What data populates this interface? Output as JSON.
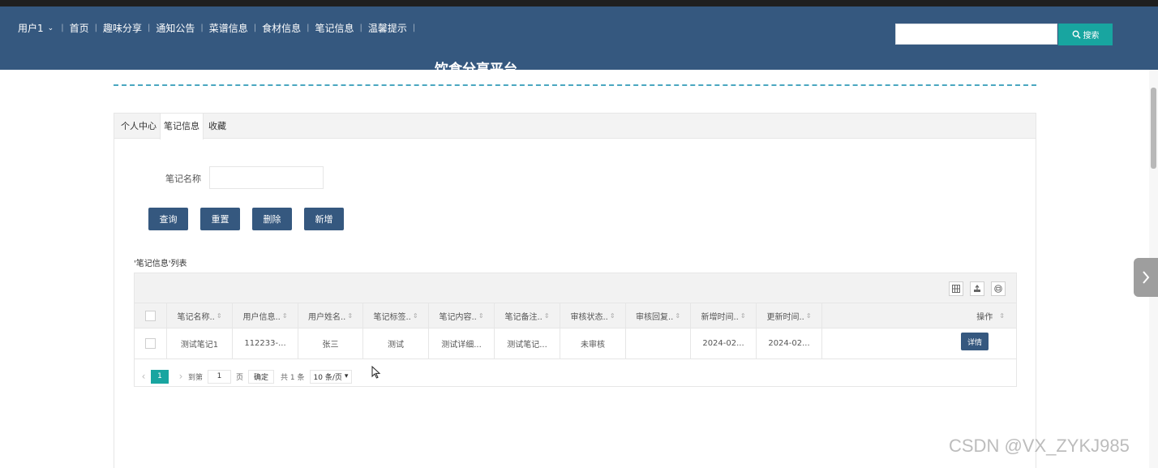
{
  "header": {
    "user_menu": "用户1",
    "nav_items": [
      "首页",
      "趣味分享",
      "通知公告",
      "菜谱信息",
      "食材信息",
      "笔记信息",
      "温馨提示"
    ],
    "search_placeholder": "",
    "search_button": "搜索",
    "site_title": "饮食分享平台"
  },
  "tabs": [
    "个人中心",
    "笔记信息",
    "收藏"
  ],
  "active_tab": "笔记信息",
  "form": {
    "label": "笔记名称",
    "value": ""
  },
  "buttons": {
    "query": "查询",
    "reset": "重置",
    "delete": "删除",
    "add": "新增"
  },
  "list_title": "'笔记信息'列表",
  "table": {
    "columns": [
      "笔记名称..",
      "用户信息..",
      "用户姓名..",
      "笔记标签..",
      "笔记内容..",
      "笔记备注..",
      "审核状态..",
      "审核回复..",
      "新增时间..",
      "更新时间..",
      "操作"
    ],
    "rows": [
      {
        "cells": [
          "测试笔记1",
          "112233-...",
          "张三",
          "测试",
          "测试详细...",
          "测试笔记...",
          "未审核",
          "",
          "2024-02...",
          "2024-02..."
        ],
        "action": "详情"
      }
    ]
  },
  "pager": {
    "current_page": "1",
    "goto_prefix": "到第",
    "goto_value": "1",
    "goto_suffix": "页",
    "confirm": "确定",
    "total": "共 1 条",
    "page_size": "10 条/页"
  },
  "watermark": "CSDN @VX_ZYKJ985",
  "colors": {
    "header_bg": "#35587f",
    "accent_teal": "#18a5a0",
    "button_bg": "#35587f"
  }
}
